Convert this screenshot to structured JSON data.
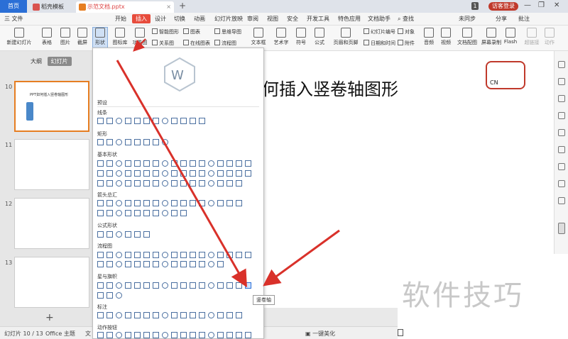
{
  "window": {
    "home_tab": "首页",
    "tab1": "稻壳模板",
    "tab2": "示范文档.pptx",
    "new_tab": "+",
    "badge_num": "1",
    "login": "访客登录"
  },
  "menubar": {
    "file": "三 文件",
    "items": [
      "开始",
      "插入",
      "设计",
      "切换",
      "动画",
      "幻灯片放映",
      "审阅",
      "视图",
      "安全",
      "开发工具",
      "特色应用",
      "文档助手"
    ],
    "search": "查找",
    "sync": "未同步",
    "share": "分享",
    "comment": "批注"
  },
  "ribbon": {
    "new_slide": "新建幻灯片",
    "table": "表格",
    "picture": "图片",
    "screenshot": "截屏",
    "shape": "形状",
    "icon_lib": "图标库",
    "function_chart": "功能图",
    "smart_art": "智能图形",
    "chart": "图表",
    "relation": "关系图",
    "online_chart": "在线图表",
    "mindmap": "思维导图",
    "flowchart": "流程图",
    "textbox": "文本框",
    "art_text": "艺术字",
    "symbol": "符号",
    "formula": "公式",
    "header_footer": "页眉和页脚",
    "slide_number": "幻灯片编号",
    "datetime": "日期和时间",
    "object": "对象",
    "attachment": "附件",
    "audio": "音频",
    "video": "视频",
    "doc_media": "文档配图",
    "screen_record": "屏幕录制",
    "flash": "Flash",
    "hyperlink": "超链接",
    "action": "动作"
  },
  "left_panel": {
    "tab_outline": "大纲",
    "tab_slides": "幻灯片",
    "slides": [
      {
        "num": "10",
        "title": "PPT如何插入竖卷轴图形"
      },
      {
        "num": "11",
        "title": ""
      },
      {
        "num": "12",
        "title": ""
      },
      {
        "num": "13",
        "title": ""
      }
    ],
    "add": "+"
  },
  "slide": {
    "title": "何插入竖卷轴图形",
    "logo_text": "CN"
  },
  "shapes_panel": {
    "preset": "预设",
    "sections": [
      "线条",
      "矩形",
      "基本形状",
      "箭头总汇",
      "公式形状",
      "流程图",
      "星与旗帜",
      "标注",
      "动作按钮"
    ],
    "tooltip": "竖卷轴"
  },
  "statusbar": {
    "slide_info": "幻灯片 10 / 13",
    "theme": "Office 主题",
    "doc": "文",
    "beautify": "一键美化"
  },
  "watermark": "软件技巧",
  "colors": {
    "accent": "#e74c3c",
    "blue": "#2b6fd6",
    "arrow": "#d9312a"
  }
}
